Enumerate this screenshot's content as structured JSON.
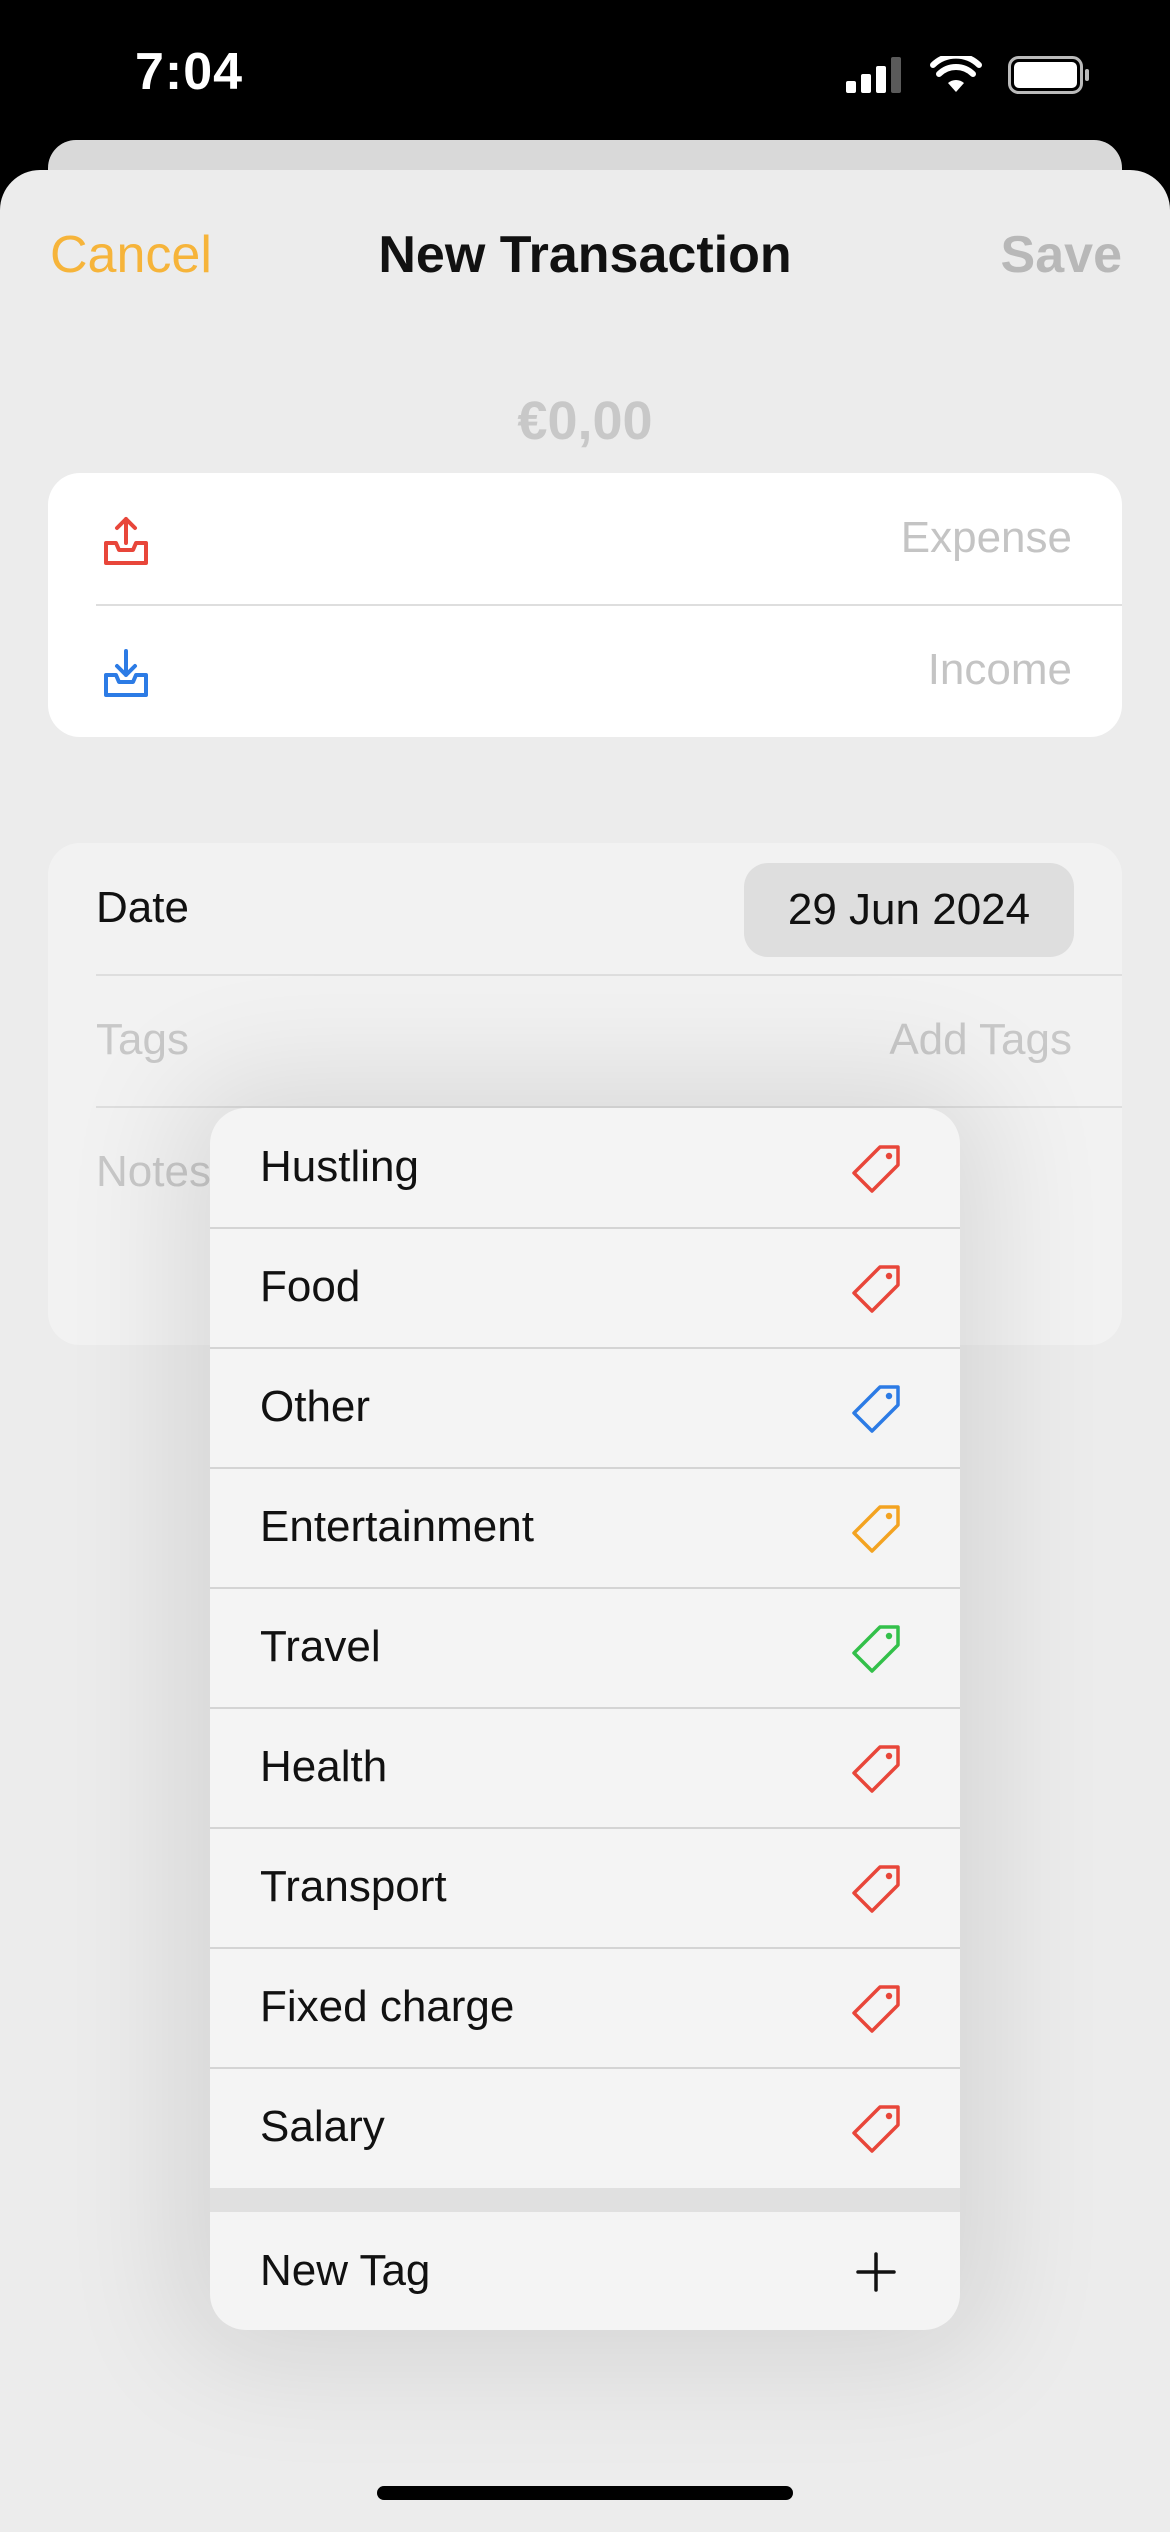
{
  "status_bar": {
    "time": "7:04"
  },
  "nav": {
    "cancel": "Cancel",
    "title": "New Transaction",
    "save": "Save"
  },
  "amount": "€0,00",
  "transaction_type": {
    "expense": "Expense",
    "income": "Income"
  },
  "details": {
    "date_label": "Date",
    "date_value": "29 Jun 2024",
    "tags_label": "Tags",
    "tags_action": "Add Tags",
    "notes_label": "Notes"
  },
  "tag_menu": {
    "items": [
      {
        "label": "Hustling",
        "color": "#e8463a"
      },
      {
        "label": "Food",
        "color": "#e8463a"
      },
      {
        "label": "Other",
        "color": "#2c7be5"
      },
      {
        "label": "Entertainment",
        "color": "#f3a321"
      },
      {
        "label": "Travel",
        "color": "#33c04a"
      },
      {
        "label": "Health",
        "color": "#e8463a"
      },
      {
        "label": "Transport",
        "color": "#e8463a"
      },
      {
        "label": "Fixed charge",
        "color": "#e8463a"
      },
      {
        "label": "Salary",
        "color": "#e8463a"
      }
    ],
    "new_tag": "New Tag"
  },
  "colors": {
    "accent": "#f6b43a",
    "expense": "#e8463a",
    "income": "#2c7be5"
  }
}
